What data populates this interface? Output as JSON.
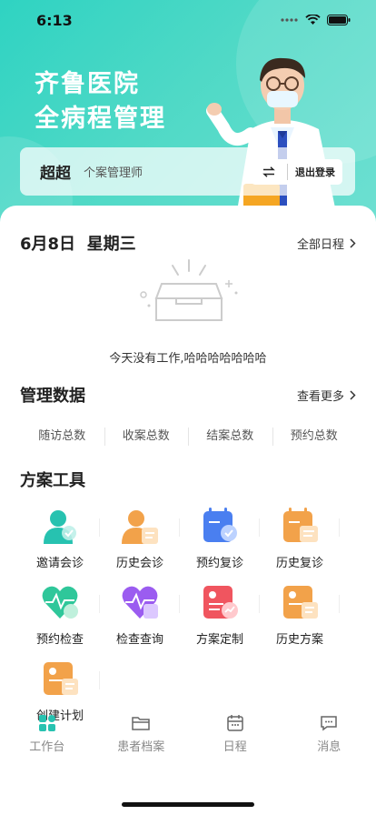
{
  "status": {
    "time": "6:13"
  },
  "hero": {
    "title_line1": "齐鲁医院",
    "title_line2": "全病程管理"
  },
  "user": {
    "name": "超超",
    "role": "个案管理师",
    "logout_label": "退出登录"
  },
  "schedule": {
    "date": "6月8日",
    "weekday": "星期三",
    "all_label": "全部日程",
    "empty_text": "今天没有工作,哈哈哈哈哈哈哈"
  },
  "management": {
    "title": "管理数据",
    "more_label": "查看更多",
    "stats": [
      "随访总数",
      "收案总数",
      "结案总数",
      "预约总数"
    ]
  },
  "tools": {
    "title": "方案工具",
    "items": [
      {
        "label": "邀请会诊",
        "icon": "invite-consult-icon",
        "color": "#27c2b0"
      },
      {
        "label": "历史会诊",
        "icon": "history-consult-icon",
        "color": "#f2a24a"
      },
      {
        "label": "预约复诊",
        "icon": "book-revisit-icon",
        "color": "#4a7ff0"
      },
      {
        "label": "历史复诊",
        "icon": "history-revisit-icon",
        "color": "#f2a24a"
      },
      {
        "label": "预约检查",
        "icon": "book-exam-icon",
        "color": "#2fc79a"
      },
      {
        "label": "检查查询",
        "icon": "exam-query-icon",
        "color": "#9b5cf0"
      },
      {
        "label": "方案定制",
        "icon": "plan-custom-icon",
        "color": "#f0555f"
      },
      {
        "label": "历史方案",
        "icon": "history-plan-icon",
        "color": "#f2a24a"
      },
      {
        "label": "创建计划",
        "icon": "create-plan-icon",
        "color": "#f2a24a"
      }
    ]
  },
  "tabs": [
    {
      "label": "工作台",
      "icon": "workbench-icon",
      "active": true
    },
    {
      "label": "患者档案",
      "icon": "folder-icon",
      "active": false
    },
    {
      "label": "日程",
      "icon": "calendar-icon",
      "active": false
    },
    {
      "label": "消息",
      "icon": "message-icon",
      "active": false
    }
  ],
  "colors": {
    "accent": "#2fd3c2",
    "tab_active": "#27c2b0",
    "tab_inactive": "#888888"
  }
}
